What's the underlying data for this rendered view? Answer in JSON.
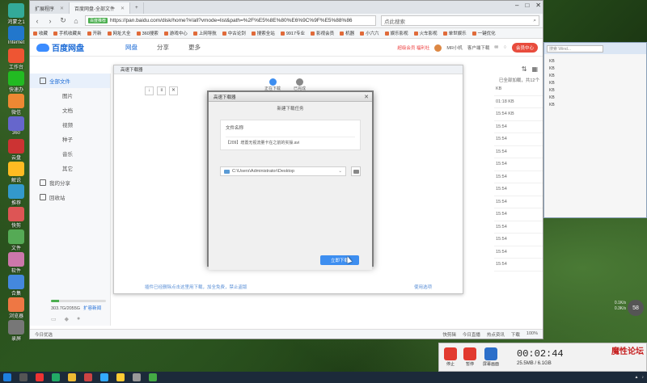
{
  "browser": {
    "tabs": [
      {
        "label": "扩展程序"
      },
      {
        "label": "百度网盘-全部文件"
      }
    ],
    "url": "https://pan.baidu.com/disk/home?#/all?vmode=list&path=%2F%E5%8E%80%E6%9C%9F%E5%88%86",
    "secure_label": "百度推荐",
    "search_placeholder": "点此搜索",
    "bookmarks": [
      "收藏",
      "手机收藏夹",
      "开新",
      "网址大全",
      "360搜索",
      "游戏中心",
      "上网导航",
      "中古论剑",
      "搜索全站",
      "9917专业",
      "影视会员",
      "机器",
      "小六六",
      "娱乐影视",
      "火车影视",
      "单世娱乐",
      "一键优化"
    ]
  },
  "app": {
    "logo": "百度网盘",
    "nav": [
      {
        "label": "网盘"
      },
      {
        "label": "分享"
      },
      {
        "label": "更多"
      }
    ],
    "header_right": {
      "promo": "超级会员 福利社",
      "user": "MR小机",
      "client": "客户端下载",
      "vip": "会员中心"
    },
    "sidebar": [
      {
        "label": "全部文件"
      },
      {
        "label": "图片"
      },
      {
        "label": "文档"
      },
      {
        "label": "视频"
      },
      {
        "label": "种子"
      },
      {
        "label": "音乐"
      },
      {
        "label": "其它"
      },
      {
        "label": "我的分享"
      },
      {
        "label": "回收站"
      }
    ],
    "quota": {
      "text": "303.7G/2055G",
      "expand": "扩容新闻",
      "used_fraction": 0.15
    },
    "list_info": "已全部加载，共12个",
    "right_column": [
      "KB",
      "01:18 KB",
      "15:54 KB",
      "15:54",
      "15:54",
      "15:54",
      "15:54",
      "15:54",
      "15:54",
      "15:54",
      "15:54",
      "15:54",
      "15:54",
      "15:54",
      "15:54"
    ]
  },
  "downloader": {
    "title": "高速下载器",
    "tabs": [
      {
        "label": "正在下载"
      },
      {
        "label": "已完成"
      }
    ],
    "footer_note": "插件已经删除点击这里用下载，加全免费，禁止盗版",
    "settings": "使用选项"
  },
  "dialog": {
    "title": "高速下载器",
    "subtitle": "新建下载任务",
    "file_label": "文件名称",
    "file_value": "【209】增置无视流量卡在之前的实操.avi",
    "path": "C:\\Users\\Administrator\\Desktop",
    "download_button": "立即下载"
  },
  "status_bar": {
    "left": "今日优选",
    "right": [
      "快剪辑",
      "今日直播",
      "热点资讯",
      "下载",
      "100%"
    ]
  },
  "explorer": {
    "search": "搜索 Wind...",
    "items": [
      "KB",
      "KB",
      "KB",
      "KB",
      "KB",
      "KB",
      "KB"
    ]
  },
  "desktop_icons": [
    "鸿蒙之1",
    "Internet",
    "工作台",
    "快速办",
    "微信",
    "360",
    "云盘",
    "解说",
    "推荐",
    "快剪",
    "文件",
    "软件",
    "合集",
    "浏览器",
    "录屏"
  ],
  "recorder": {
    "stop": "停止",
    "pause": "暂停",
    "screen": "屏幕画面",
    "time": "00:02:44",
    "size": "25.5MB / 6.1GB",
    "watermark": "魔性论坛"
  },
  "timer_badge": "58",
  "net_speed": [
    "0.1K/s",
    "0.3K/s"
  ]
}
